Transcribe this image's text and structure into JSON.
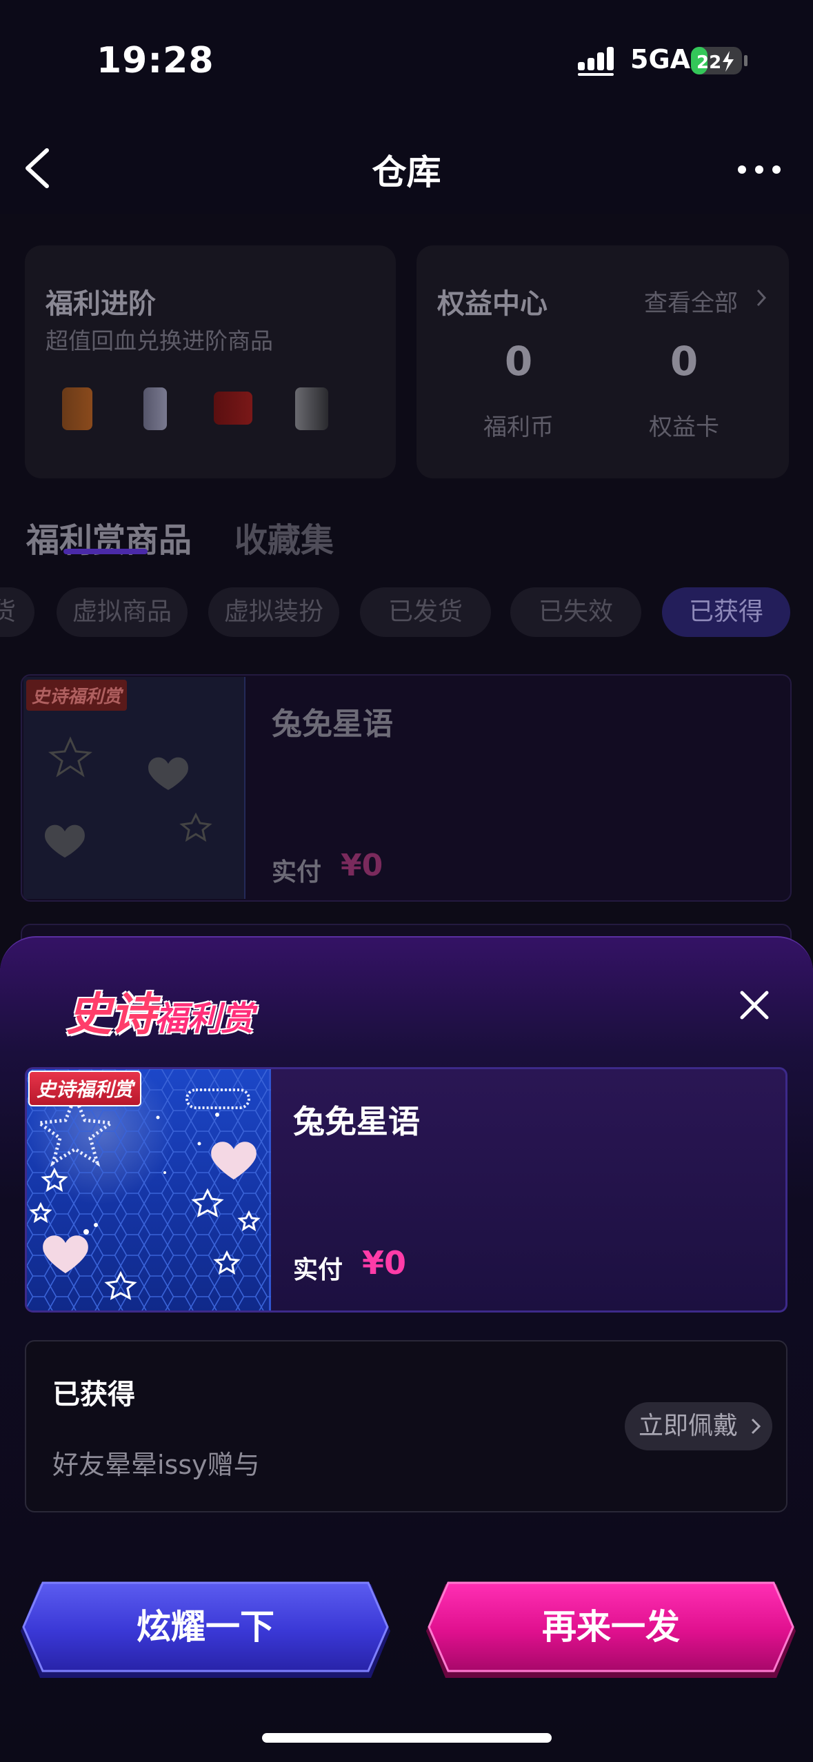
{
  "status_bar": {
    "time": "19:28",
    "network": "5GA",
    "battery": "22"
  },
  "nav": {
    "title": "仓库"
  },
  "welfare_card": {
    "title": "福利进阶",
    "subtitle": "超值回血兑换进阶商品"
  },
  "rights_card": {
    "title": "权益中心",
    "view_all": "查看全部",
    "stats": [
      {
        "value": "0",
        "label": "福利币"
      },
      {
        "value": "0",
        "label": "权益卡"
      }
    ]
  },
  "tabs": [
    {
      "label": "福利赏商品"
    },
    {
      "label": "收藏集"
    }
  ],
  "filters": [
    {
      "label": "货"
    },
    {
      "label": "虚拟商品"
    },
    {
      "label": "虚拟装扮"
    },
    {
      "label": "已发货"
    },
    {
      "label": "已失效"
    },
    {
      "label": "已获得"
    }
  ],
  "background_item": {
    "badge": "史诗福利赏",
    "name": "兔免星语",
    "paid_label": "实付",
    "price": "¥0"
  },
  "sheet": {
    "logo_main": "史诗",
    "logo_sub": "福利赏",
    "item": {
      "badge": "史诗福利赏",
      "name": "兔免星语",
      "paid_label": "实付",
      "price": "¥0"
    },
    "status": {
      "title": "已获得",
      "description": "好友晕晕issy赠与",
      "wear_button": "立即佩戴"
    },
    "buttons": {
      "show_off": "炫耀一下",
      "again": "再来一发"
    }
  }
}
